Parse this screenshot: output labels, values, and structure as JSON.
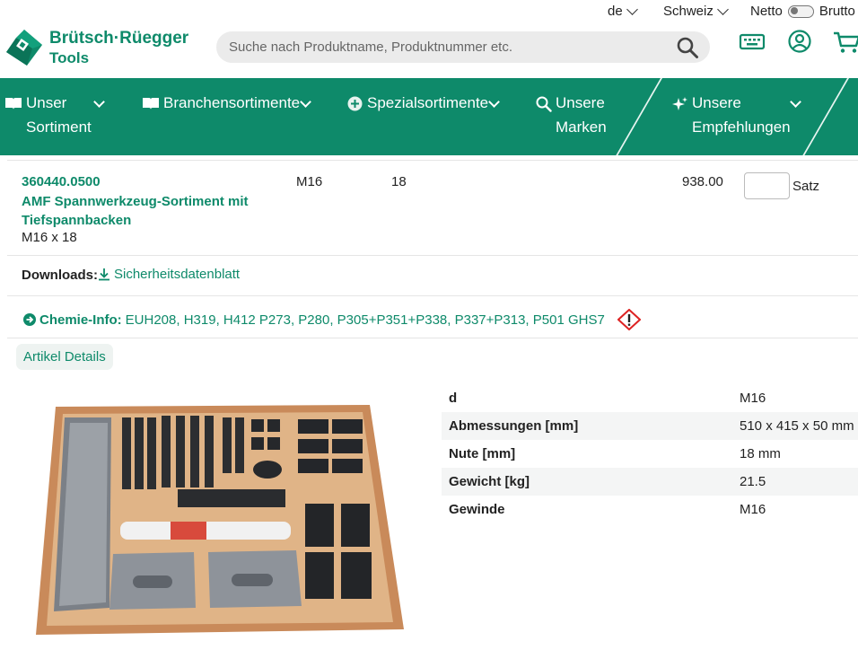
{
  "util": {
    "language": "de",
    "country": "Schweiz",
    "price_mode_left": "Netto",
    "price_mode_right": "Brutto"
  },
  "brand": {
    "line1": "Brütsch·Rüegger",
    "line2": "Tools",
    "color": "#0e8a6a"
  },
  "search": {
    "placeholder": "Suche nach Produktname, Produktnummer etc."
  },
  "nav": {
    "items": [
      {
        "line1": "Unser",
        "line2": "Sortiment",
        "icon": "book-icon"
      },
      {
        "line1": "Branchensortimente",
        "icon": "book-icon"
      },
      {
        "line1": "Spezialsortimente",
        "icon": "plus-circle-icon"
      },
      {
        "line1": "Unsere",
        "line2": "Marken",
        "icon": "search-icon"
      },
      {
        "line1": "Unsere",
        "line2": "Empfehlungen",
        "icon": "sparkle-icon"
      }
    ]
  },
  "product": {
    "number": "360440.0500",
    "name": "AMF Spannwerkzeug-Sortiment mit Tiefspannbacken",
    "subtitle": "M16 x 18",
    "col_thread": "M16",
    "col_slot": "18",
    "price": "938.00",
    "qty_value": "",
    "unit": "Satz"
  },
  "downloads": {
    "label": "Downloads:",
    "link": "Sicherheitsdatenblatt"
  },
  "chemie": {
    "label": "Chemie-Info:",
    "text": "EUH208, H319, H412 P273, P280, P305+P351+P338, P337+P313, P501 GHS7"
  },
  "tabs": {
    "details": "Artikel Details"
  },
  "specs": [
    {
      "key": "d",
      "value": "M16"
    },
    {
      "key": "Abmessungen [mm]",
      "value": "510 x 415 x 50 mm"
    },
    {
      "key": "Nute [mm]",
      "value": "18 mm"
    },
    {
      "key": "Gewicht [kg]",
      "value": "21.5"
    },
    {
      "key": "Gewinde",
      "value": "M16"
    }
  ]
}
